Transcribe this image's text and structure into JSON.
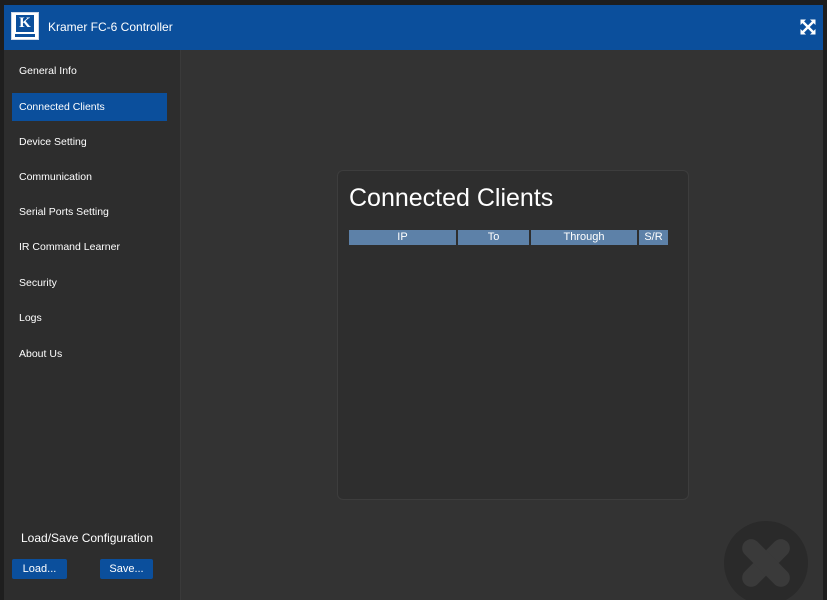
{
  "header": {
    "title": "Kramer FC-6 Controller",
    "logo_letter": "K"
  },
  "sidebar": {
    "items": [
      {
        "label": "General Info"
      },
      {
        "label": "Connected Clients"
      },
      {
        "label": "Device Setting"
      },
      {
        "label": "Communication"
      },
      {
        "label": "Serial Ports Setting"
      },
      {
        "label": "IR Command Learner"
      },
      {
        "label": "Security"
      },
      {
        "label": "Logs"
      },
      {
        "label": "About Us"
      }
    ],
    "active_item": "Connected Clients",
    "config": {
      "title": "Load/Save Configuration",
      "load_label": "Load...",
      "save_label": "Save..."
    }
  },
  "main": {
    "title": "Connected Clients",
    "columns": [
      "IP",
      "To",
      "Through",
      "S/R"
    ],
    "rows": []
  },
  "colors": {
    "accent": "#0b4f9c",
    "table_header": "#5d81a8",
    "sidebar_bg": "#2d2d2d",
    "main_bg": "#333333"
  },
  "icons": {
    "fullscreen": "fullscreen-toggle-icon",
    "watermark": "kramer-watermark-icon"
  }
}
